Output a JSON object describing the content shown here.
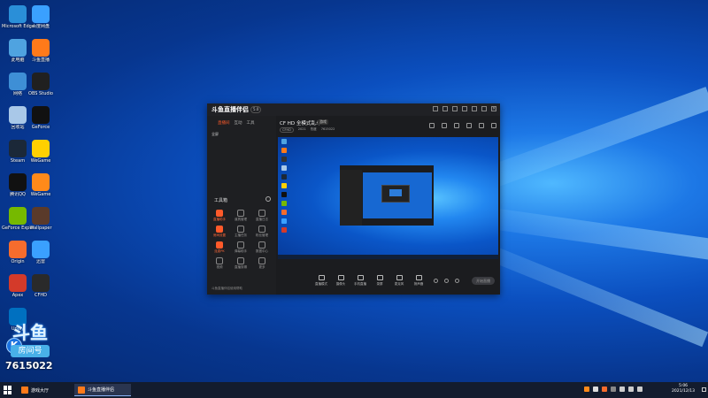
{
  "colors": {
    "accent": "#ff5a2a",
    "taskbar": "#131c2e",
    "desktop": "#0b4fbf"
  },
  "desktop_icons": [
    {
      "label": "Microsoft Edge",
      "color": "#2a8fd8"
    },
    {
      "label": "百度网盘",
      "color": "#3aa0ff"
    },
    {
      "label": "此电脑",
      "color": "#4fa3e0"
    },
    {
      "label": "斗鱼直播",
      "color": "#ff7a1a"
    },
    {
      "label": "网络",
      "color": "#3e8fd6"
    },
    {
      "label": "OBS Studio",
      "color": "#202020"
    },
    {
      "label": "回收站",
      "color": "#a9c8e8"
    },
    {
      "label": "GeForce",
      "color": "#111"
    },
    {
      "label": "Steam",
      "color": "#1b2838"
    },
    {
      "label": "WeGame",
      "color": "#ffd000"
    },
    {
      "label": "腾讯QQ",
      "color": "#111"
    },
    {
      "label": "WeGame",
      "color": "#ff8a1a"
    },
    {
      "label": "GeForce Experience",
      "color": "#76b900"
    },
    {
      "label": "Wallpaper",
      "color": "#5a3a2a"
    },
    {
      "label": "Origin",
      "color": "#f56c2d"
    },
    {
      "label": "迅雷",
      "color": "#3aa0ff"
    },
    {
      "label": "Apex",
      "color": "#d43a2a"
    },
    {
      "label": "CFHD",
      "color": "#2a2a2a"
    },
    {
      "label": "Uplay",
      "color": "#0070c0"
    }
  ],
  "streamer_badge": {
    "title": "斗鱼",
    "tag": "房间号",
    "number": "7615022"
  },
  "app": {
    "title": "斗鱼直播伴侣",
    "version": "5.0",
    "left_tabs": [
      "直播间",
      "互动",
      "工具"
    ],
    "row_text": "全屏",
    "toolbox_title": "工具箱",
    "tools": [
      {
        "label": "直播助手",
        "hot": true
      },
      {
        "label": "道具管理",
        "hot": false
      },
      {
        "label": "直播日志",
        "hot": false
      },
      {
        "label": "房间设置",
        "hot": true
      },
      {
        "label": "主播任务",
        "hot": false
      },
      {
        "label": "粉丝管理",
        "hot": false
      },
      {
        "label": "连麦PK",
        "hot": true
      },
      {
        "label": "弹幕助手",
        "hot": false
      },
      {
        "label": "数据中心",
        "hot": false
      },
      {
        "label": "视频",
        "hot": false
      },
      {
        "label": "直播剪辑",
        "hot": false
      },
      {
        "label": "更多",
        "hot": false
      }
    ],
    "footer_text": "斗鱼直播伴侣使用帮助",
    "stream_title": "CF HD 全模式乱斗",
    "stream_tag": "游戏",
    "stream_meta": [
      "CFHD",
      "2021",
      "热度",
      "7615022"
    ],
    "controls": [
      "直播模式",
      "摄像头",
      "手机直播",
      "录屏",
      "麦克风",
      "扬声器"
    ],
    "start_label": "开始直播"
  },
  "taskbar": {
    "apps": [
      {
        "label": "游戏大厅",
        "active": false
      },
      {
        "label": "斗鱼直播伴侣",
        "active": true
      }
    ],
    "time": "5:06",
    "date": "2021/12/13"
  }
}
